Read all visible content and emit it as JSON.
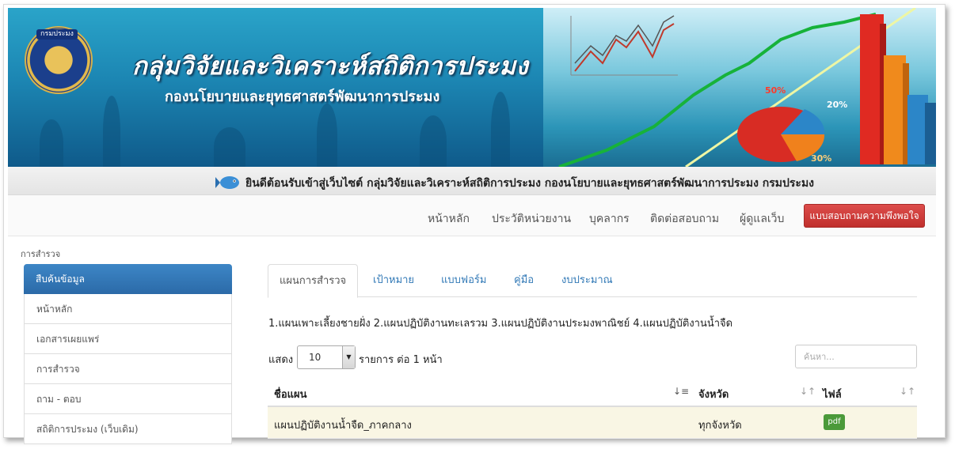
{
  "banner": {
    "logo_text": "กรมประมง",
    "title": "กลุ่มวิจัยและวิเคราะห์สถิติการประมง",
    "subtitle": "กองนโยบายและยุทธศาสตร์พัฒนาการประมง",
    "pie_labels": [
      "50%",
      "20%",
      "30%"
    ]
  },
  "welcome": {
    "text": "ยินดีต้อนรับเข้าสู่เว็บไซต์ กลุ่มวิจัยและวิเคราะห์สถิติการประมง กองนโยบายและยุทธศาสตร์พัฒนาการประมง กรมประมง"
  },
  "nav": {
    "items": [
      "หน้าหลัก",
      "ประวัติหน่วยงาน",
      "บุคลากร",
      "ติดต่อสอบถาม",
      "ผู้ดูแลเว็บ"
    ],
    "survey_button": "แบบสอบถามความพึงพอใจ"
  },
  "breadcrumb": "การสำรวจ",
  "sidebar": {
    "header": "สืบค้นข้อมูล",
    "items": [
      "หน้าหลัก",
      "เอกสารเผยแพร่",
      "การสำรวจ",
      "ถาม - ตอบ",
      "สถิติการประมง (เว็บเดิม)"
    ]
  },
  "tabs": [
    "แผนการสำรวจ",
    "เป้าหมาย",
    "แบบฟอร์ม",
    "คู่มือ",
    "งบประมาณ"
  ],
  "plan_description": "1.แผนเพาะเลี้ยงชายฝั่ง 2.แผนปฏิบัติงานทะเลรวม 3.แผนปฏิบัติงานประมงพาณิชย์ 4.แผนปฏิบัติงานน้ำจืด",
  "length_control": {
    "show_label": "แสดง",
    "value": "10",
    "per_page_label": "รายการ ต่อ 1 หน้า"
  },
  "search": {
    "placeholder": "ค้นหา..."
  },
  "table": {
    "headers": [
      "ชื่อแผน",
      "จังหวัด",
      "ไฟล์"
    ],
    "rows": [
      {
        "name": "แผนปฏิบัติงานน้ำจืด_ภาคกลาง",
        "province": "ทุกจังหวัด",
        "file": "pdf"
      }
    ]
  },
  "colors": {
    "banner_blue": "#1c86b3",
    "sidebar_header": "#2b6aa8",
    "survey_button": "#c02f2c",
    "link": "#337ab7",
    "pdf_badge": "#4b9a3a",
    "row_highlight": "#f9f6e4"
  }
}
